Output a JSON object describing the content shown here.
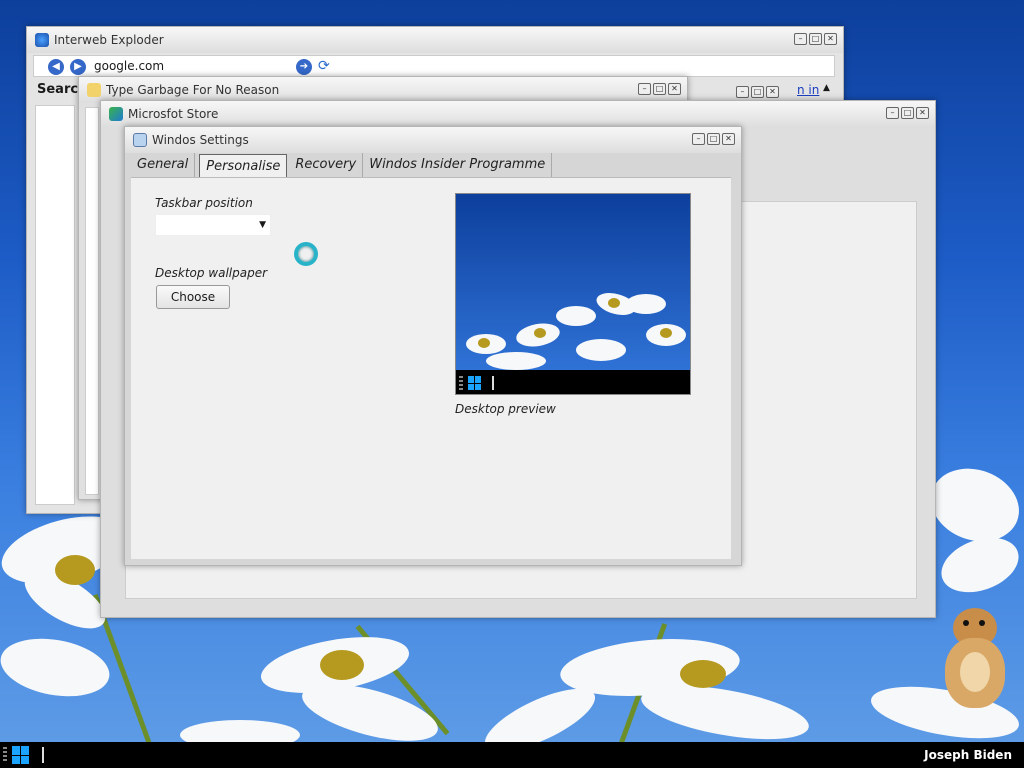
{
  "windows": {
    "explorer": {
      "title": "Interweb Exploder",
      "address": "google.com",
      "search_label": "Search",
      "signin_label": "n in"
    },
    "garbage": {
      "title": "Type Garbage For No Reason"
    },
    "store": {
      "title": "Microsfot Store"
    },
    "settings": {
      "title": "Windos Settings",
      "tabs": [
        {
          "label": "General"
        },
        {
          "label": "Personalise"
        },
        {
          "label": "Recovery"
        },
        {
          "label": "Windos Insider Programme"
        }
      ],
      "taskbar_position_label": "Taskbar position",
      "taskbar_position_value": "",
      "wallpaper_label": "Desktop wallpaper",
      "choose_label": "Choose",
      "preview_label": "Desktop preview"
    }
  },
  "window_buttons": {
    "minimize": "–",
    "maximize": "□",
    "close": "✕"
  },
  "taskbar": {
    "user": "Joseph Biden"
  },
  "colors": {
    "accent": "#1aa3ff",
    "taskbar": "#000000",
    "spinner": "#29b3c9"
  }
}
